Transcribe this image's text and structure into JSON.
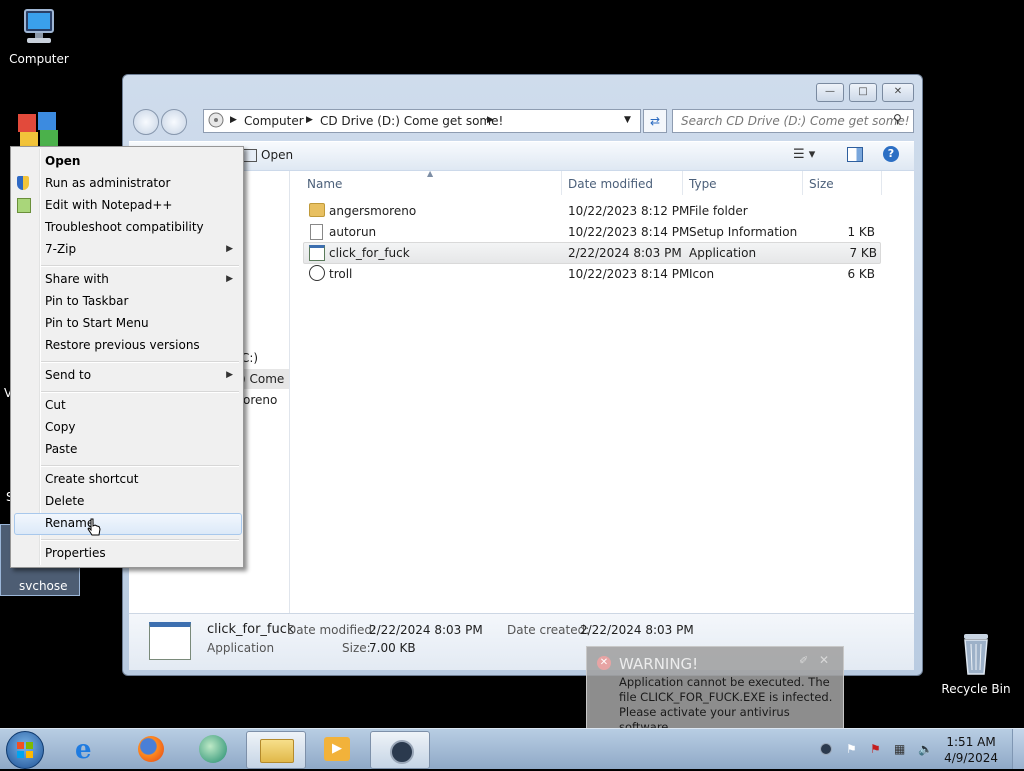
{
  "desktop": {
    "computer_label": "Computer",
    "recycle_label": "Recycle Bin",
    "svchose_label": "svchose",
    "partial_left_1": "V",
    "partial_left_2": "S"
  },
  "window": {
    "caption_buttons": [
      "—",
      "□",
      "✕"
    ],
    "breadcrumb": [
      "Computer",
      "CD Drive (D:) Come get some!"
    ],
    "search_placeholder": "Search CD Drive (D:) Come get some!",
    "toolbar": {
      "open_label": "Open"
    },
    "navpane": {
      "items": [
        "C:)",
        ") Come",
        "oreno"
      ]
    },
    "columns": [
      "Name",
      "Date modified",
      "Type",
      "Size"
    ],
    "files": [
      {
        "name": "angersmoreno",
        "date": "10/22/2023 8:12 PM",
        "type": "File folder",
        "size": ""
      },
      {
        "name": "autorun",
        "date": "10/22/2023 8:14 PM",
        "type": "Setup Information",
        "size": "1 KB"
      },
      {
        "name": "click_for_fuck",
        "date": "2/22/2024 8:03 PM",
        "type": "Application",
        "size": "7 KB"
      },
      {
        "name": "troll",
        "date": "10/22/2023 8:14 PM",
        "type": "Icon",
        "size": "6 KB"
      }
    ],
    "details": {
      "name": "click_for_fuck",
      "type": "Application",
      "date_modified_label": "Date modified:",
      "date_modified": "2/22/2024 8:03 PM",
      "size_label": "Size:",
      "size": "7.00 KB",
      "date_created_label": "Date created:",
      "date_created": "2/22/2024 8:03 PM"
    }
  },
  "context_menu": {
    "items": [
      "Open",
      "Run as administrator",
      "Edit with Notepad++",
      "Troubleshoot compatibility",
      "7-Zip",
      "Share with",
      "Pin to Taskbar",
      "Pin to Start Menu",
      "Restore previous versions",
      "Send to",
      "Cut",
      "Copy",
      "Paste",
      "Create shortcut",
      "Delete",
      "Rename",
      "Properties"
    ]
  },
  "warning": {
    "title": "WARNING!",
    "message": "Application cannot be executed. The file CLICK_FOR_FUCK.EXE is infected. Please activate your antivirus software."
  },
  "taskbar": {
    "time": "1:51 AM",
    "date": "4/9/2024"
  },
  "colors": {
    "desktop": "#000000",
    "taskbar": "#a6bdd8",
    "menu_highlight": "#dce9f8"
  }
}
